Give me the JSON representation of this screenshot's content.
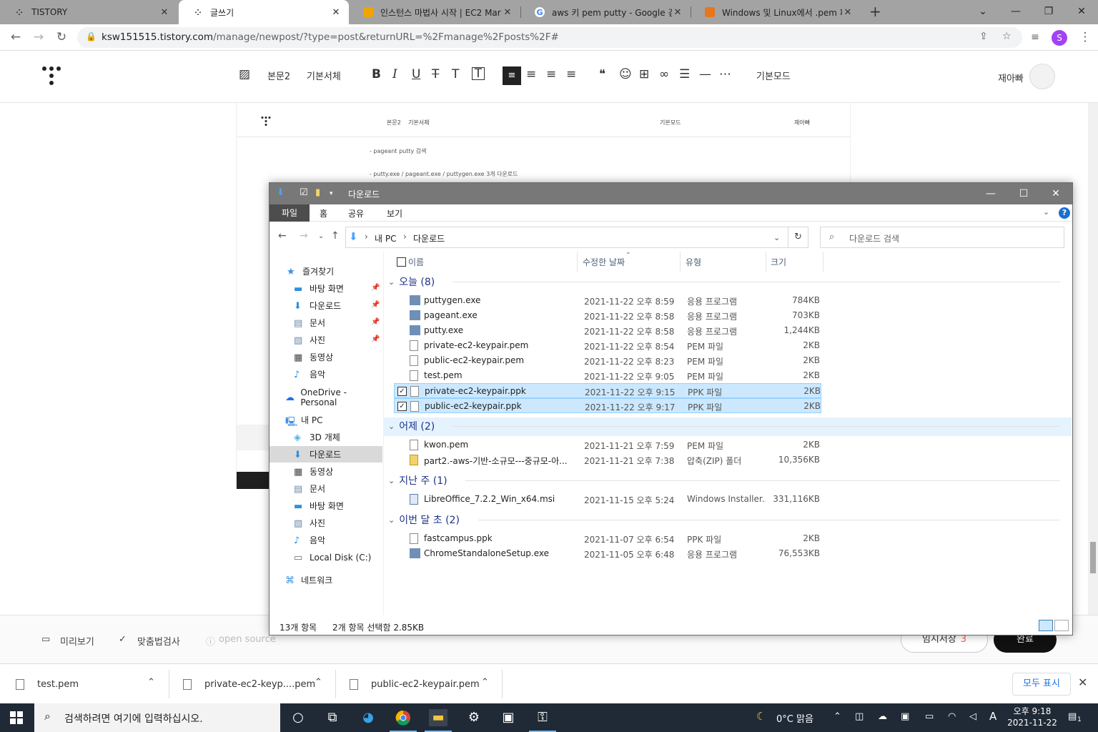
{
  "browser": {
    "tabs": [
      {
        "title": "TISTORY",
        "favicon": "tistory-icon"
      },
      {
        "title": "글쓰기",
        "favicon": "tistory-icon"
      },
      {
        "title": "인스턴스 마법사 시작 | EC2 Mar",
        "favicon": "aws-icon"
      },
      {
        "title": "aws 키 pem putty - Google 검색",
        "favicon": "google-icon"
      },
      {
        "title": "Windows 및 Linux에서 .pem 파일",
        "favicon": "aws-icon"
      }
    ],
    "url_host": "ksw151515.tistory.com",
    "url_path": "/manage/newpost/?type=post&returnURL=%2Fmanage%2Fposts%2F#",
    "profile_initial": "S"
  },
  "editor": {
    "toolbar": {
      "paragraph_style": "본문2",
      "font": "기본서체",
      "mode": "기본모드"
    },
    "user_name": "재아빠",
    "embedded_screenshot": {
      "line1": "- pageant putty 검색",
      "line2": "- putty.exe / pageant.exe / puttygen.exe 3개 다운로드"
    },
    "footer": {
      "preview": "미리보기",
      "spellcheck": "맞춤법검사",
      "open_source": "open source",
      "draft_label": "임시저장",
      "draft_count": "3",
      "done_label": "완료"
    }
  },
  "explorer": {
    "title": "다운로드",
    "ribbon_tabs": [
      "파일",
      "홈",
      "공유",
      "보기"
    ],
    "address": {
      "root": "내 PC",
      "current": "다운로드"
    },
    "search_placeholder": "다운로드 검색",
    "sidebar": {
      "quick_access": "즐겨찾기",
      "quick_items": [
        {
          "label": "바탕 화면",
          "icon": "desktop-icon"
        },
        {
          "label": "다운로드",
          "icon": "download-icon"
        },
        {
          "label": "문서",
          "icon": "document-icon"
        },
        {
          "label": "사진",
          "icon": "pictures-icon"
        },
        {
          "label": "동영상",
          "icon": "video-icon"
        },
        {
          "label": "음악",
          "icon": "music-icon"
        }
      ],
      "onedrive": "OneDrive - Personal",
      "this_pc": "내 PC",
      "pc_items": [
        {
          "label": "3D 개체",
          "icon": "3d-objects-icon"
        },
        {
          "label": "다운로드",
          "icon": "download-icon"
        },
        {
          "label": "동영상",
          "icon": "video-icon"
        },
        {
          "label": "문서",
          "icon": "document-icon"
        },
        {
          "label": "바탕 화면",
          "icon": "desktop-icon"
        },
        {
          "label": "사진",
          "icon": "pictures-icon"
        },
        {
          "label": "음악",
          "icon": "music-icon"
        },
        {
          "label": "Local Disk (C:)",
          "icon": "disk-icon"
        }
      ],
      "network": "네트워크"
    },
    "columns": {
      "name": "이름",
      "date": "수정한 날짜",
      "type": "유형",
      "size": "크기"
    },
    "groups": [
      {
        "label": "오늘 (8)",
        "files": [
          {
            "name": "puttygen.exe",
            "date": "2021-11-22 오후 8:59",
            "type": "응용 프로그램",
            "size": "784KB",
            "kind": "exe",
            "selected": false
          },
          {
            "name": "pageant.exe",
            "date": "2021-11-22 오후 8:58",
            "type": "응용 프로그램",
            "size": "703KB",
            "kind": "exe",
            "selected": false
          },
          {
            "name": "putty.exe",
            "date": "2021-11-22 오후 8:58",
            "type": "응용 프로그램",
            "size": "1,244KB",
            "kind": "exe",
            "selected": false
          },
          {
            "name": "private-ec2-keypair.pem",
            "date": "2021-11-22 오후 8:54",
            "type": "PEM 파일",
            "size": "2KB",
            "kind": "file",
            "selected": false
          },
          {
            "name": "public-ec2-keypair.pem",
            "date": "2021-11-22 오후 8:23",
            "type": "PEM 파일",
            "size": "2KB",
            "kind": "file",
            "selected": false
          },
          {
            "name": "test.pem",
            "date": "2021-11-22 오후 9:05",
            "type": "PEM 파일",
            "size": "2KB",
            "kind": "file",
            "selected": false
          },
          {
            "name": "private-ec2-keypair.ppk",
            "date": "2021-11-22 오후 9:15",
            "type": "PPK 파일",
            "size": "2KB",
            "kind": "file",
            "selected": true
          },
          {
            "name": "public-ec2-keypair.ppk",
            "date": "2021-11-22 오후 9:17",
            "type": "PPK 파일",
            "size": "2KB",
            "kind": "file",
            "selected": true
          }
        ]
      },
      {
        "label": "어제 (2)",
        "files": [
          {
            "name": "kwon.pem",
            "date": "2021-11-21 오후 7:59",
            "type": "PEM 파일",
            "size": "2KB",
            "kind": "file",
            "selected": false
          },
          {
            "name": "part2.-aws-기반-소규모---중규모-아...",
            "date": "2021-11-21 오후 7:38",
            "type": "압축(ZIP) 폴더",
            "size": "10,356KB",
            "kind": "zip",
            "selected": false
          }
        ]
      },
      {
        "label": "지난 주 (1)",
        "files": [
          {
            "name": "LibreOffice_7.2.2_Win_x64.msi",
            "date": "2021-11-15 오후 5:24",
            "type": "Windows Installer...",
            "size": "331,116KB",
            "kind": "msi",
            "selected": false
          }
        ]
      },
      {
        "label": "이번 달 초 (2)",
        "files": [
          {
            "name": "fastcampus.ppk",
            "date": "2021-11-07 오후 6:54",
            "type": "PPK 파일",
            "size": "2KB",
            "kind": "file",
            "selected": false
          },
          {
            "name": "ChromeStandaloneSetup.exe",
            "date": "2021-11-05 오후 6:48",
            "type": "응용 프로그램",
            "size": "76,553KB",
            "kind": "exe",
            "selected": false
          }
        ]
      }
    ],
    "status": {
      "count": "13개 항목",
      "selection": "2개 항목 선택함 2.85KB"
    }
  },
  "downloads": {
    "items": [
      "test.pem",
      "private-ec2-keyp....pem",
      "public-ec2-keypair.pem"
    ],
    "show_all": "모두 표시"
  },
  "taskbar": {
    "search_placeholder": "검색하려면 여기에 입력하십시오.",
    "weather": "0°C 맑음",
    "ime": "A",
    "time": "오후 9:18",
    "date": "2021-11-22",
    "notification_count": "1"
  },
  "colors": {
    "selection": "#cce8ff",
    "selection_border": "#99d1ff",
    "group_header": "#1e3287",
    "explorer_title": "#787878",
    "taskbar": "#1f2a36"
  }
}
